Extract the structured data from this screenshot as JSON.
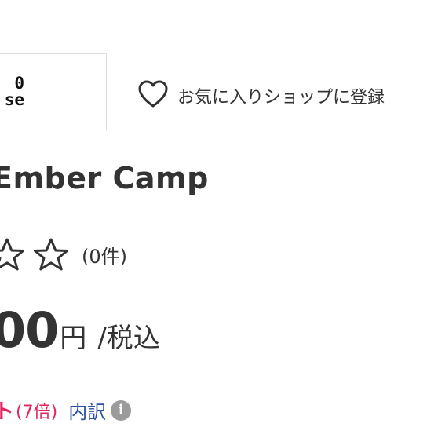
{
  "shop_logo": {
    "line1": "0",
    "line2": "se"
  },
  "favorite": {
    "label": "お気に入りショップに登録",
    "icon": "heart-outline-icon"
  },
  "product": {
    "title": "Ember Camp"
  },
  "rating": {
    "stars_filled": 0,
    "stars_visible": 2,
    "count_text": "(0件)",
    "star_icon": "star-outline-icon"
  },
  "price": {
    "value": "00",
    "unit": "円",
    "tax_note": "/税込"
  },
  "points": {
    "label": "ト",
    "multiplier": "(7倍)",
    "breakdown_link": "内訳",
    "info_icon": "info-icon",
    "accent_color": "#e0245e",
    "link_color": "#2a4fa8"
  }
}
